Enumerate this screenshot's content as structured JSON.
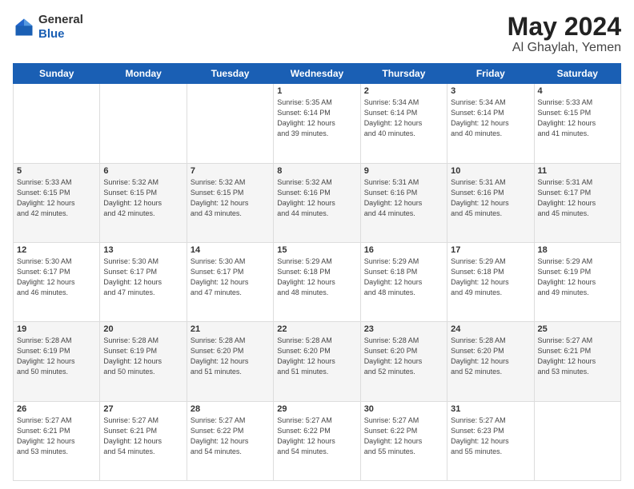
{
  "header": {
    "logo_line1": "General",
    "logo_line2": "Blue",
    "title": "May 2024",
    "subtitle": "Al Ghaylah, Yemen"
  },
  "weekdays": [
    "Sunday",
    "Monday",
    "Tuesday",
    "Wednesday",
    "Thursday",
    "Friday",
    "Saturday"
  ],
  "weeks": [
    [
      {
        "day": "",
        "info": ""
      },
      {
        "day": "",
        "info": ""
      },
      {
        "day": "",
        "info": ""
      },
      {
        "day": "1",
        "info": "Sunrise: 5:35 AM\nSunset: 6:14 PM\nDaylight: 12 hours\nand 39 minutes."
      },
      {
        "day": "2",
        "info": "Sunrise: 5:34 AM\nSunset: 6:14 PM\nDaylight: 12 hours\nand 40 minutes."
      },
      {
        "day": "3",
        "info": "Sunrise: 5:34 AM\nSunset: 6:14 PM\nDaylight: 12 hours\nand 40 minutes."
      },
      {
        "day": "4",
        "info": "Sunrise: 5:33 AM\nSunset: 6:15 PM\nDaylight: 12 hours\nand 41 minutes."
      }
    ],
    [
      {
        "day": "5",
        "info": "Sunrise: 5:33 AM\nSunset: 6:15 PM\nDaylight: 12 hours\nand 42 minutes."
      },
      {
        "day": "6",
        "info": "Sunrise: 5:32 AM\nSunset: 6:15 PM\nDaylight: 12 hours\nand 42 minutes."
      },
      {
        "day": "7",
        "info": "Sunrise: 5:32 AM\nSunset: 6:15 PM\nDaylight: 12 hours\nand 43 minutes."
      },
      {
        "day": "8",
        "info": "Sunrise: 5:32 AM\nSunset: 6:16 PM\nDaylight: 12 hours\nand 44 minutes."
      },
      {
        "day": "9",
        "info": "Sunrise: 5:31 AM\nSunset: 6:16 PM\nDaylight: 12 hours\nand 44 minutes."
      },
      {
        "day": "10",
        "info": "Sunrise: 5:31 AM\nSunset: 6:16 PM\nDaylight: 12 hours\nand 45 minutes."
      },
      {
        "day": "11",
        "info": "Sunrise: 5:31 AM\nSunset: 6:17 PM\nDaylight: 12 hours\nand 45 minutes."
      }
    ],
    [
      {
        "day": "12",
        "info": "Sunrise: 5:30 AM\nSunset: 6:17 PM\nDaylight: 12 hours\nand 46 minutes."
      },
      {
        "day": "13",
        "info": "Sunrise: 5:30 AM\nSunset: 6:17 PM\nDaylight: 12 hours\nand 47 minutes."
      },
      {
        "day": "14",
        "info": "Sunrise: 5:30 AM\nSunset: 6:17 PM\nDaylight: 12 hours\nand 47 minutes."
      },
      {
        "day": "15",
        "info": "Sunrise: 5:29 AM\nSunset: 6:18 PM\nDaylight: 12 hours\nand 48 minutes."
      },
      {
        "day": "16",
        "info": "Sunrise: 5:29 AM\nSunset: 6:18 PM\nDaylight: 12 hours\nand 48 minutes."
      },
      {
        "day": "17",
        "info": "Sunrise: 5:29 AM\nSunset: 6:18 PM\nDaylight: 12 hours\nand 49 minutes."
      },
      {
        "day": "18",
        "info": "Sunrise: 5:29 AM\nSunset: 6:19 PM\nDaylight: 12 hours\nand 49 minutes."
      }
    ],
    [
      {
        "day": "19",
        "info": "Sunrise: 5:28 AM\nSunset: 6:19 PM\nDaylight: 12 hours\nand 50 minutes."
      },
      {
        "day": "20",
        "info": "Sunrise: 5:28 AM\nSunset: 6:19 PM\nDaylight: 12 hours\nand 50 minutes."
      },
      {
        "day": "21",
        "info": "Sunrise: 5:28 AM\nSunset: 6:20 PM\nDaylight: 12 hours\nand 51 minutes."
      },
      {
        "day": "22",
        "info": "Sunrise: 5:28 AM\nSunset: 6:20 PM\nDaylight: 12 hours\nand 51 minutes."
      },
      {
        "day": "23",
        "info": "Sunrise: 5:28 AM\nSunset: 6:20 PM\nDaylight: 12 hours\nand 52 minutes."
      },
      {
        "day": "24",
        "info": "Sunrise: 5:28 AM\nSunset: 6:20 PM\nDaylight: 12 hours\nand 52 minutes."
      },
      {
        "day": "25",
        "info": "Sunrise: 5:27 AM\nSunset: 6:21 PM\nDaylight: 12 hours\nand 53 minutes."
      }
    ],
    [
      {
        "day": "26",
        "info": "Sunrise: 5:27 AM\nSunset: 6:21 PM\nDaylight: 12 hours\nand 53 minutes."
      },
      {
        "day": "27",
        "info": "Sunrise: 5:27 AM\nSunset: 6:21 PM\nDaylight: 12 hours\nand 54 minutes."
      },
      {
        "day": "28",
        "info": "Sunrise: 5:27 AM\nSunset: 6:22 PM\nDaylight: 12 hours\nand 54 minutes."
      },
      {
        "day": "29",
        "info": "Sunrise: 5:27 AM\nSunset: 6:22 PM\nDaylight: 12 hours\nand 54 minutes."
      },
      {
        "day": "30",
        "info": "Sunrise: 5:27 AM\nSunset: 6:22 PM\nDaylight: 12 hours\nand 55 minutes."
      },
      {
        "day": "31",
        "info": "Sunrise: 5:27 AM\nSunset: 6:23 PM\nDaylight: 12 hours\nand 55 minutes."
      },
      {
        "day": "",
        "info": ""
      }
    ]
  ]
}
